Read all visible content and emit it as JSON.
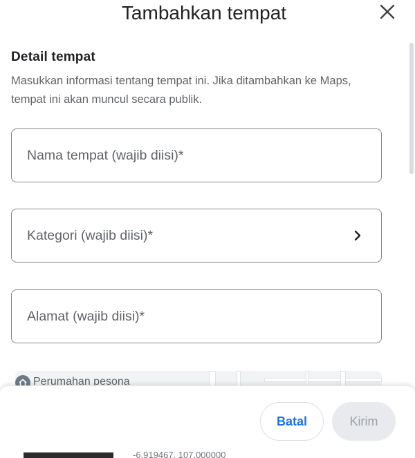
{
  "dialog": {
    "title": "Tambahkan tempat",
    "close_icon": "close-icon"
  },
  "section": {
    "title": "Detail tempat",
    "description": "Masukkan informasi tentang tempat ini. Jika ditambahkan ke Maps, tempat ini akan muncul secara publik."
  },
  "fields": {
    "name": {
      "placeholder": "Nama tempat (wajib diisi)*",
      "value": ""
    },
    "category": {
      "label": "Kategori (wajib diisi)*",
      "icon": "chevron-right-icon"
    },
    "address": {
      "placeholder": "Alamat (wajib diisi)*",
      "value": ""
    }
  },
  "map": {
    "place_label": "Perumahan pesona",
    "place_icon": "place-pin-icon",
    "coordinates": "-6.919467, 107.000000"
  },
  "footer": {
    "cancel_label": "Batal",
    "submit_label": "Kirim"
  },
  "colors": {
    "accent": "#1a73e8",
    "text_primary": "#202124",
    "text_secondary": "#5f6368",
    "border": "#80868b",
    "disabled_bg": "#e8eaed",
    "disabled_text": "#9aa0a6"
  }
}
